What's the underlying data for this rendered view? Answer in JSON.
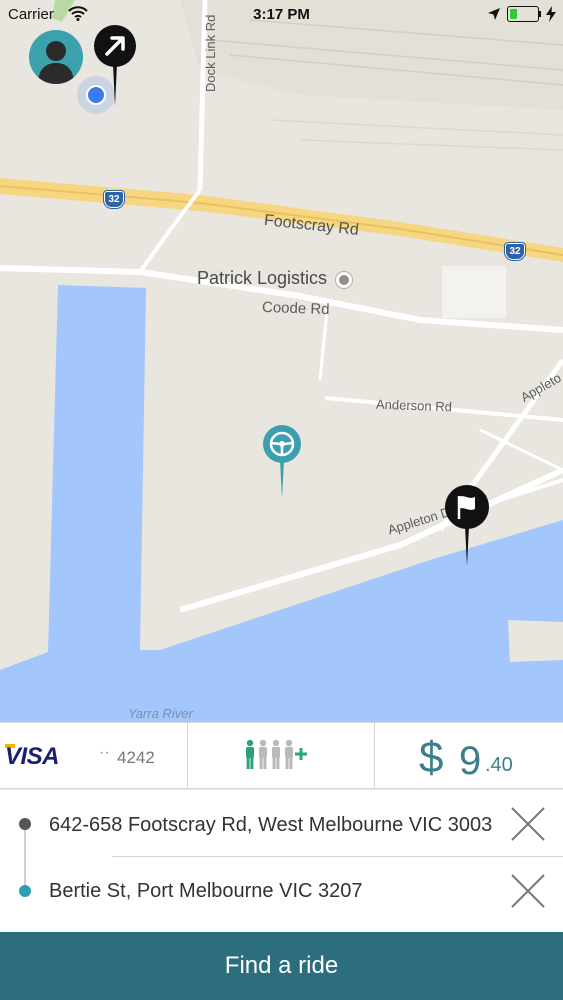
{
  "status_bar": {
    "carrier": "Carrier",
    "time": "3:17 PM",
    "battery_level": 0.3
  },
  "map": {
    "poi_label": "Patrick Logistics",
    "roads": {
      "footscray": "Footscray Rd",
      "coode": "Coode Rd",
      "anderson": "Anderson Rd",
      "appleton": "Appleton Dock Rd",
      "appleton_short": "Appleto",
      "dock_link": "Dock Link Rd"
    },
    "river": "Yarra River",
    "route_shield": "32",
    "icons": {
      "start_pin": "arrow-up-right-icon",
      "driver_pin": "steering-wheel-icon",
      "dest_pin": "flag-icon",
      "user": "avatar-icon",
      "location": "current-location-dot"
    }
  },
  "trip_info": {
    "card_brand": "VISA",
    "card_dots": "··",
    "card_last4": "4242",
    "riders_icon": "riders-add-icon",
    "fare_currency": "$",
    "fare_major": "9",
    "fare_minor": ".40"
  },
  "route": {
    "origin": "642-658 Footscray Rd, West Melbourne VIC 3003",
    "destination": "Bertie St, Port Melbourne VIC 3207"
  },
  "actions": {
    "find_ride": "Find a ride"
  },
  "colors": {
    "accent": "#2c6e7e",
    "fare": "#3b7e8c",
    "destination_dot": "#2e9fae",
    "water": "#a3c6fc",
    "land": "#e9e6df"
  }
}
